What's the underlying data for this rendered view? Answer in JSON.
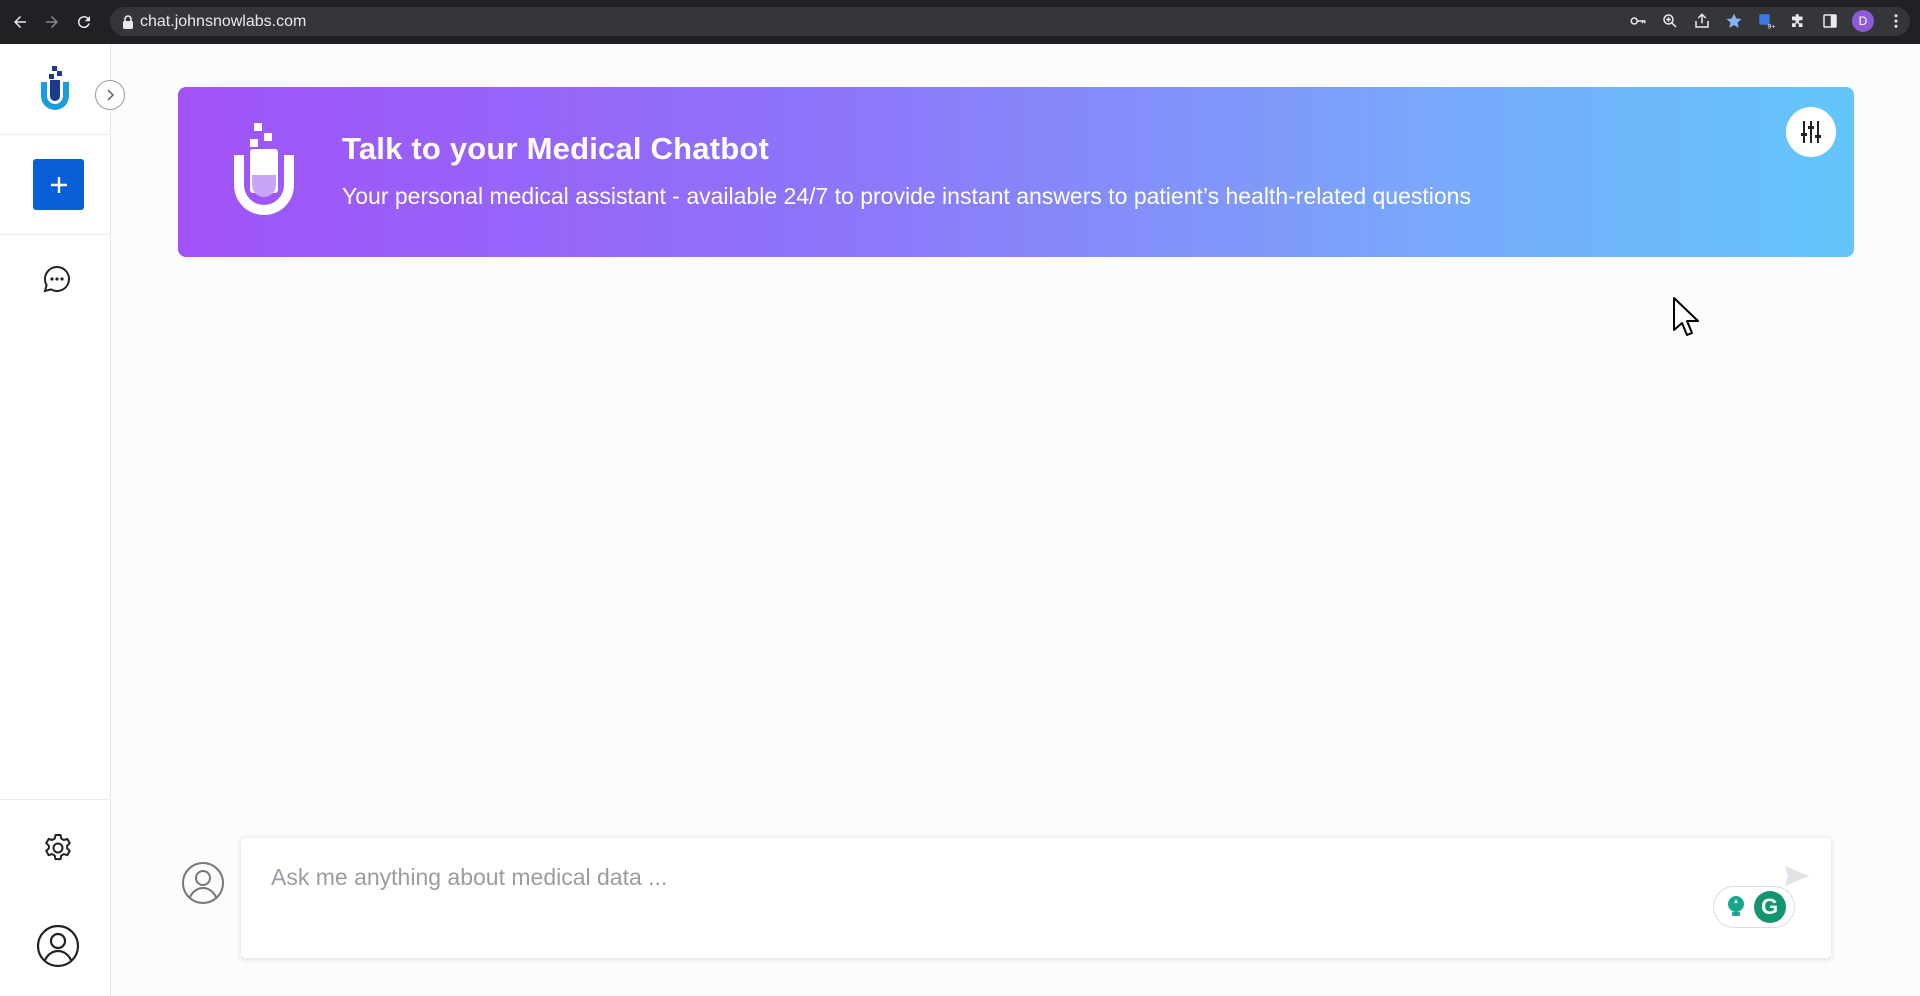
{
  "browser": {
    "url": "chat.johnsnowlabs.com",
    "profile_initial": "D"
  },
  "sidebar": {
    "icons": [
      "logo-icon",
      "chevron-right-icon",
      "plus-icon",
      "chat-bubble-icon",
      "gear-icon",
      "user-icon"
    ]
  },
  "banner": {
    "title": "Talk to your Medical Chatbot",
    "subtitle": "Your personal medical assistant - available 24/7 to provide instant answers to patient’s health-related questions"
  },
  "chat_input": {
    "placeholder": "Ask me anything about medical data ...",
    "value": ""
  },
  "grammarly": {
    "logo_letter": "G"
  },
  "colors": {
    "accent": "#0b5fd6",
    "banner_start": "#a152f8",
    "banner_end": "#62c6fa"
  }
}
